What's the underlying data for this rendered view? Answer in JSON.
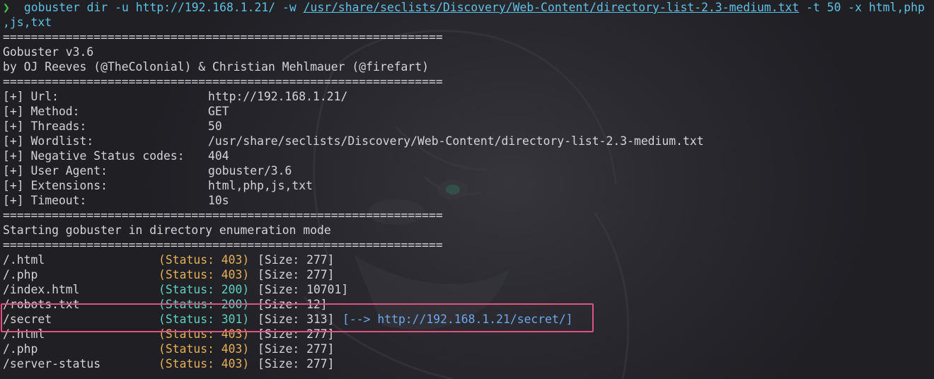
{
  "command": {
    "prompt_symbol": "❯",
    "line1": "gobuster dir -u http://192.168.1.21/ -w /usr/share/seclists/Discovery/Web-Content/directory-list-2.3-medium.txt -t 50 -x html,php",
    "line1_prefix": " gobuster dir -u http://192.168.1.21/ -w ",
    "wordlist_path": "/usr/share/seclists/Discovery/Web-Content/directory-list-2.3-medium.txt",
    "line1_suffix": " -t 50 -x html,php",
    "line2": ",js,txt"
  },
  "separator": "===============================================================",
  "banner": {
    "title": "Gobuster v3.6",
    "authors": "by OJ Reeves (@TheColonial) & Christian Mehlmauer (@firefart)"
  },
  "config": [
    {
      "label": "[+] Url:",
      "value": "http://192.168.1.21/"
    },
    {
      "label": "[+] Method:",
      "value": "GET"
    },
    {
      "label": "[+] Threads:",
      "value": "50"
    },
    {
      "label": "[+] Wordlist:",
      "value": "/usr/share/seclists/Discovery/Web-Content/directory-list-2.3-medium.txt"
    },
    {
      "label": "[+] Negative Status codes:",
      "value": "404"
    },
    {
      "label": "[+] User Agent:",
      "value": "gobuster/3.6"
    },
    {
      "label": "[+] Extensions:",
      "value": "html,php,js,txt"
    },
    {
      "label": "[+] Timeout:",
      "value": "10s"
    }
  ],
  "start_message": "Starting gobuster in directory enumeration mode",
  "results": [
    {
      "path": "/.html",
      "status": "(Status: 403)",
      "code": 403,
      "size": "[Size: 277]",
      "redirect": ""
    },
    {
      "path": "/.php",
      "status": "(Status: 403)",
      "code": 403,
      "size": "[Size: 277]",
      "redirect": ""
    },
    {
      "path": "/index.html",
      "status": "(Status: 200)",
      "code": 200,
      "size": "[Size: 10701]",
      "redirect": ""
    },
    {
      "path": "/robots.txt",
      "status": "(Status: 200)",
      "code": 200,
      "size": "[Size: 12]",
      "redirect": ""
    },
    {
      "path": "/secret",
      "status": "(Status: 301)",
      "code": 301,
      "size": "[Size: 313]",
      "redirect": "[--> http://192.168.1.21/secret/]"
    },
    {
      "path": "/.html",
      "status": "(Status: 403)",
      "code": 403,
      "size": "[Size: 277]",
      "redirect": ""
    },
    {
      "path": "/.php",
      "status": "(Status: 403)",
      "code": 403,
      "size": "[Size: 277]",
      "redirect": ""
    },
    {
      "path": "/server-status",
      "status": "(Status: 403)",
      "code": 403,
      "size": "[Size: 277]",
      "redirect": ""
    }
  ],
  "colors": {
    "prompt": "#4ec04e",
    "command": "#5ec1e6",
    "status_403": "#e5b05a",
    "status_2xx_3xx": "#5fd1c0",
    "redirect": "#6fa6ee",
    "highlight_border": "#e0537f",
    "text": "#d4d4d8",
    "background": "#1f1f24"
  }
}
